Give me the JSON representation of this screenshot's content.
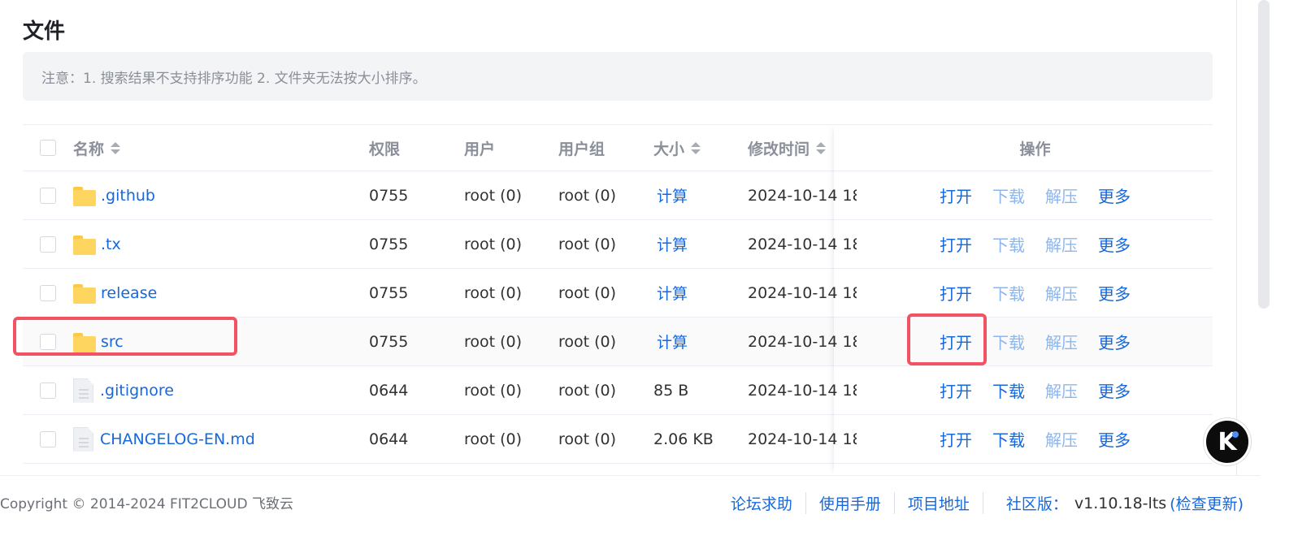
{
  "page": {
    "title": "文件"
  },
  "notice": {
    "text": "注意：1. 搜索结果不支持排序功能 2. 文件夹无法按大小排序。"
  },
  "table": {
    "columns": {
      "name": "名称",
      "permission": "权限",
      "user": "用户",
      "group": "用户组",
      "size": "大小",
      "modified": "修改时间",
      "actions": "操作"
    },
    "rows": [
      {
        "icon": "folder-icon",
        "name": ".github",
        "permission": "0755",
        "user": "root (0)",
        "group": "root (0)",
        "size": "计算",
        "modified": "2024-10-14 18",
        "download_enabled": false
      },
      {
        "icon": "folder-icon",
        "name": ".tx",
        "permission": "0755",
        "user": "root (0)",
        "group": "root (0)",
        "size": "计算",
        "modified": "2024-10-14 18",
        "download_enabled": false
      },
      {
        "icon": "folder-icon",
        "name": "release",
        "permission": "0755",
        "user": "root (0)",
        "group": "root (0)",
        "size": "计算",
        "modified": "2024-10-14 18",
        "download_enabled": false
      },
      {
        "icon": "folder-icon",
        "name": "src",
        "permission": "0755",
        "user": "root (0)",
        "group": "root (0)",
        "size": "计算",
        "modified": "2024-10-14 18",
        "download_enabled": false
      },
      {
        "icon": "file-icon",
        "name": ".gitignore",
        "permission": "0644",
        "user": "root (0)",
        "group": "root (0)",
        "size": "85 B",
        "modified": "2024-10-14 18",
        "download_enabled": true
      },
      {
        "icon": "file-icon",
        "name": "CHANGELOG-EN.md",
        "permission": "0644",
        "user": "root (0)",
        "group": "root (0)",
        "size": "2.06 KB",
        "modified": "2024-10-14 18",
        "download_enabled": true
      }
    ],
    "actions": {
      "open": "打开",
      "download": "下载",
      "unzip": "解压",
      "more": "更多"
    }
  },
  "footer": {
    "copyright": "Copyright © 2014-2024 FIT2CLOUD 飞致云",
    "links": [
      "论坛求助",
      "使用手册",
      "项目地址"
    ],
    "version_label": "社区版：",
    "version": "v1.10.18-lts",
    "check_update": "(检查更新)"
  },
  "colors": {
    "link": "#1668dc",
    "disabled_link": "#8db6ed",
    "highlight": "#f25262",
    "folder": "#fdd55f"
  }
}
